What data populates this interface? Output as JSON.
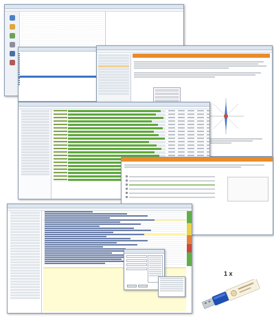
{
  "quantity_label": "1 x",
  "colors": {
    "accent_orange": "#e98b2a",
    "progress_green": "#5fa83b",
    "selection_blue": "#3a75c4",
    "dongle_blue": "#1f4fb4"
  },
  "windows": {
    "explorer": {
      "icons": [
        "home-icon",
        "folder-icon",
        "copy-icon",
        "gear-icon",
        "user-icon",
        "tool-icon"
      ]
    },
    "document": {
      "compass_icon": "compass-icon"
    },
    "progress_list": {
      "rows": [
        0.95,
        0.9,
        0.98,
        0.86,
        0.92,
        0.97,
        0.88,
        0.93,
        0.99,
        0.83,
        0.91,
        0.96,
        0.89,
        0.94,
        0.87,
        0.97,
        0.9,
        0.93,
        0.8,
        0.95,
        0.92
      ]
    },
    "question_dialog": {
      "options_count": 6,
      "checked_option_index": 2
    }
  },
  "product": {
    "icon": "usb-dongle-icon"
  }
}
